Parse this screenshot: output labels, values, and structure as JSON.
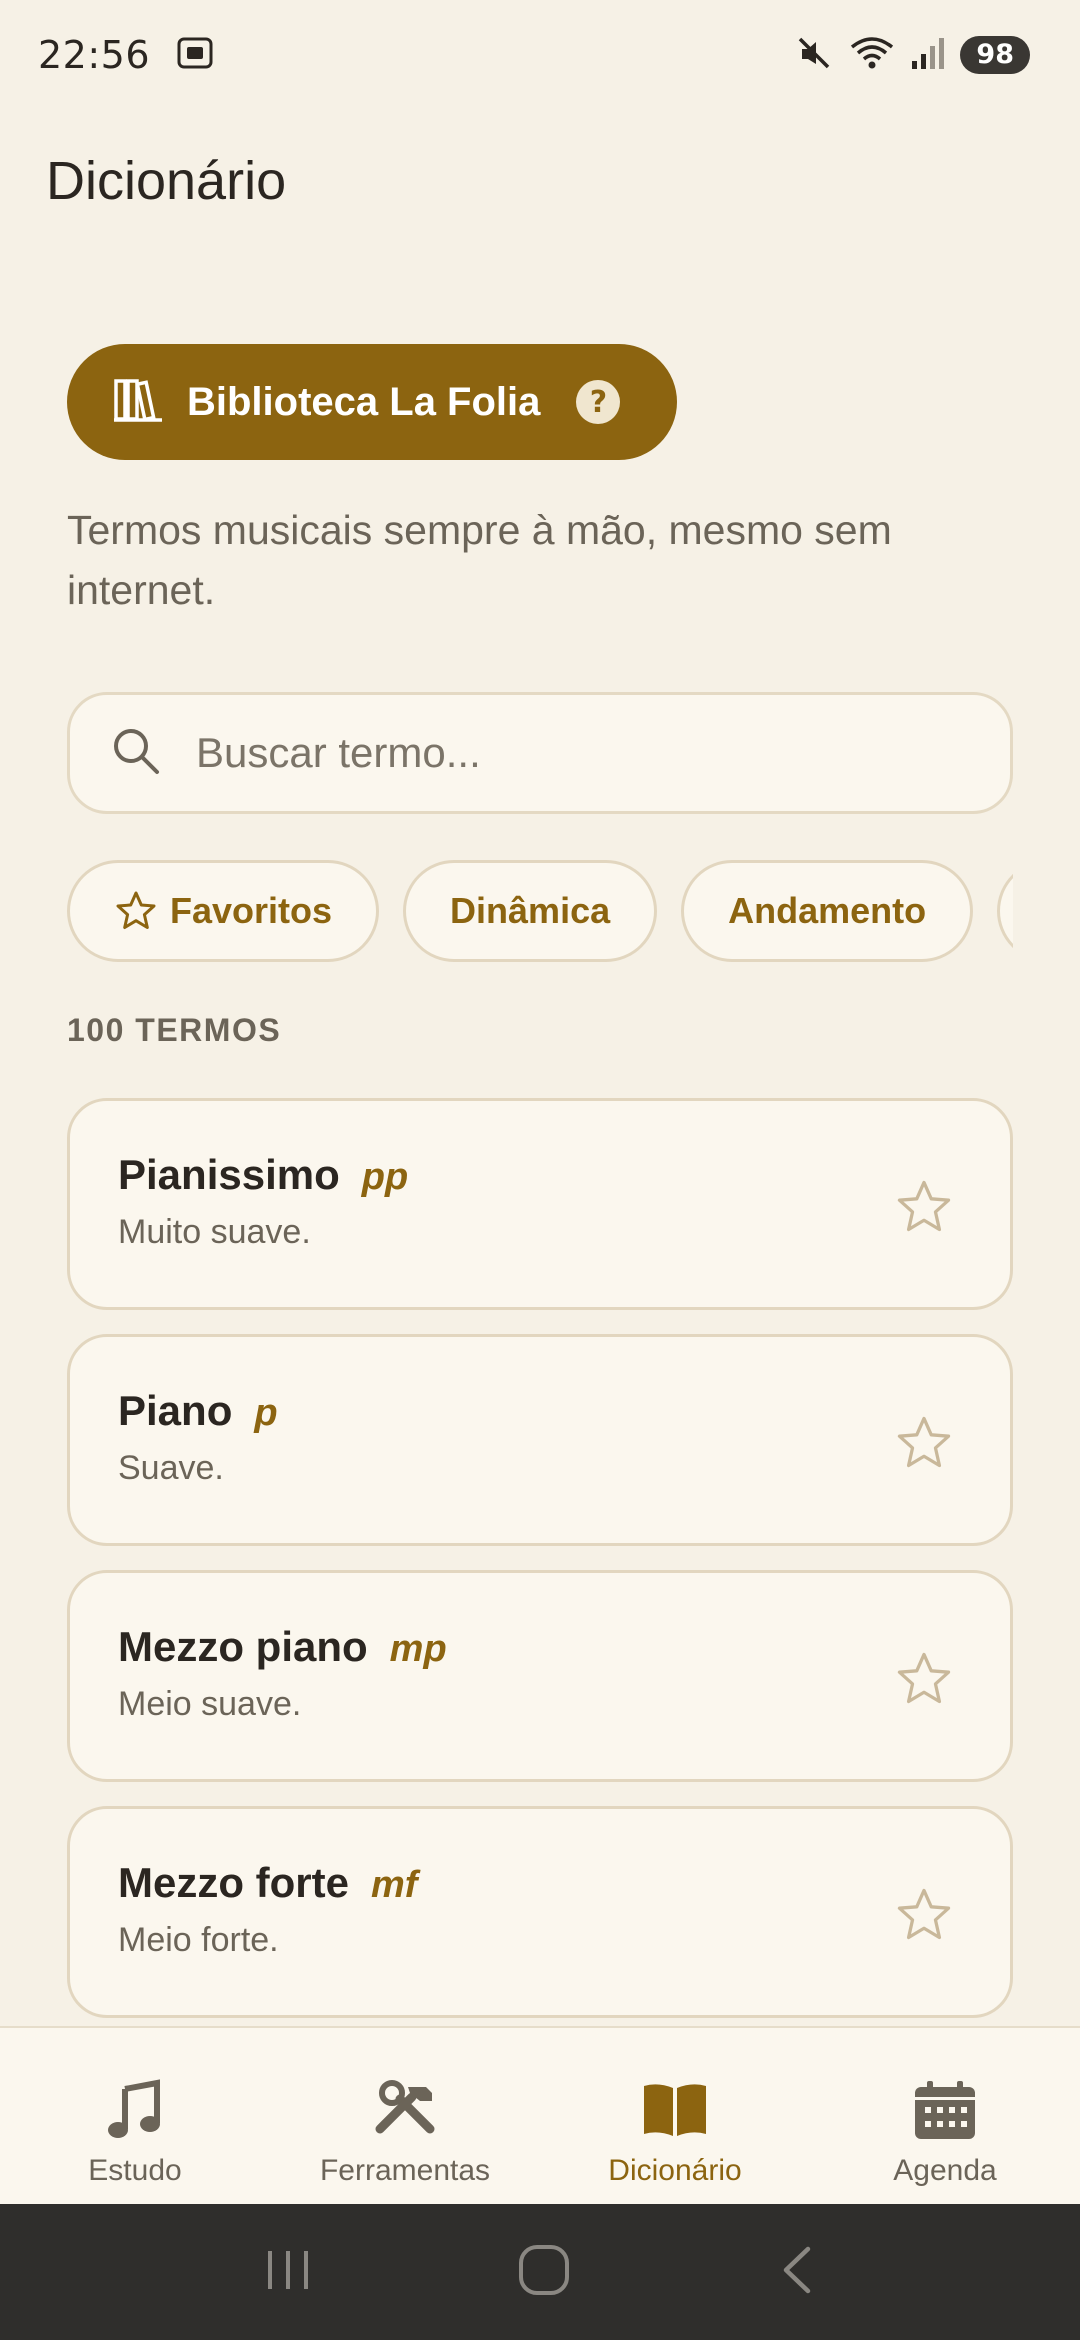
{
  "status_bar": {
    "time": "22:56",
    "battery": "98",
    "icons": [
      "screenshot-icon",
      "mute-icon",
      "wifi-icon",
      "signal-icon"
    ]
  },
  "header": {
    "title": "Dicionário"
  },
  "library": {
    "label": "Biblioteca La Folia",
    "help": "?"
  },
  "description": "Termos musicais sempre à mão, mesmo sem internet.",
  "search": {
    "placeholder": "Buscar termo..."
  },
  "chips": [
    {
      "label": "Favoritos",
      "icon": "star-outline-icon"
    },
    {
      "label": "Dinâmica"
    },
    {
      "label": "Andamento"
    },
    {
      "label": ""
    }
  ],
  "count_label": "100 TERMOS",
  "terms": [
    {
      "name": "Pianissimo",
      "abbr": "pp",
      "meaning": "Muito suave."
    },
    {
      "name": "Piano",
      "abbr": "p",
      "meaning": "Suave."
    },
    {
      "name": "Mezzo piano",
      "abbr": "mp",
      "meaning": "Meio suave."
    },
    {
      "name": "Mezzo forte",
      "abbr": "mf",
      "meaning": "Meio forte."
    }
  ],
  "bottom_nav": [
    {
      "label": "Estudo",
      "icon": "music-note-icon",
      "active": false
    },
    {
      "label": "Ferramentas",
      "icon": "tools-icon",
      "active": false
    },
    {
      "label": "Dicionário",
      "icon": "book-icon",
      "active": true
    },
    {
      "label": "Agenda",
      "icon": "calendar-icon",
      "active": false
    }
  ],
  "colors": {
    "accent": "#8c6410",
    "background": "#f6f1e6",
    "card": "#fbf7ee"
  }
}
